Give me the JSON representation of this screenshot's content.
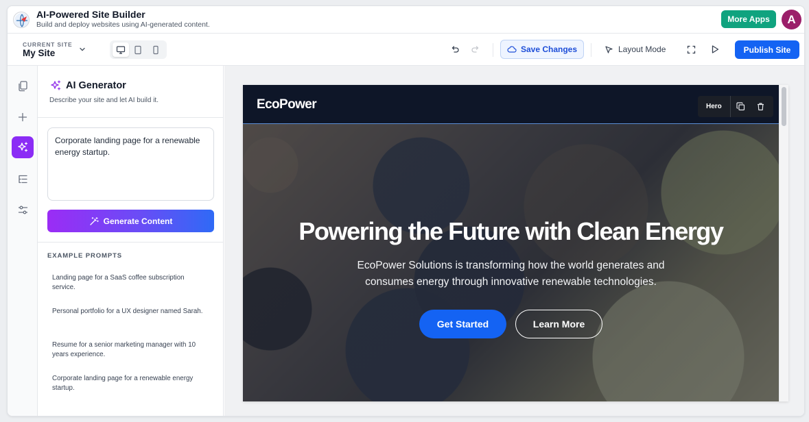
{
  "app": {
    "title": "AI-Powered Site Builder",
    "subtitle": "Build and deploy websites using AI-generated content.",
    "more_apps_label": "More Apps",
    "avatar_initial": "A"
  },
  "toolbar": {
    "current_site_label": "CURRENT SITE",
    "current_site_name": "My Site",
    "active_device": "desktop",
    "save_label": "Save Changes",
    "layout_mode_label": "Layout Mode",
    "publish_label": "Publish Site"
  },
  "rail": {
    "items": [
      {
        "icon": "pages-icon",
        "active": false
      },
      {
        "icon": "add-icon",
        "active": false
      },
      {
        "icon": "ai-sparkle-icon",
        "active": true
      },
      {
        "icon": "layers-icon",
        "active": false
      },
      {
        "icon": "settings-sliders-icon",
        "active": false
      }
    ]
  },
  "panel": {
    "title": "AI Generator",
    "subtitle": "Describe your site and let AI build it.",
    "prompt_value": "Corporate landing page for a renewable energy startup.",
    "generate_label": "Generate Content",
    "examples_label": "EXAMPLE PROMPTS",
    "examples": [
      "Landing page for a SaaS coffee subscription service.",
      "Personal portfolio for a UX designer named Sarah.",
      "Resume for a senior marketing manager with 10 years experience.",
      "Corporate landing page for a renewable energy startup."
    ]
  },
  "preview": {
    "brand": "EcoPower",
    "selected_section_label": "Hero",
    "hero_title": "Powering the Future with Clean Energy",
    "hero_text": "EcoPower Solutions is transforming how the world generates and consumes energy through innovative renewable technologies.",
    "primary_cta": "Get Started",
    "secondary_cta": "Learn More"
  },
  "colors": {
    "accent": "#1463f3",
    "more_apps": "#10a37f",
    "ai_active": "#8b2cf5",
    "avatar": "#9b1f6a",
    "site_nav": "#0e1628"
  }
}
